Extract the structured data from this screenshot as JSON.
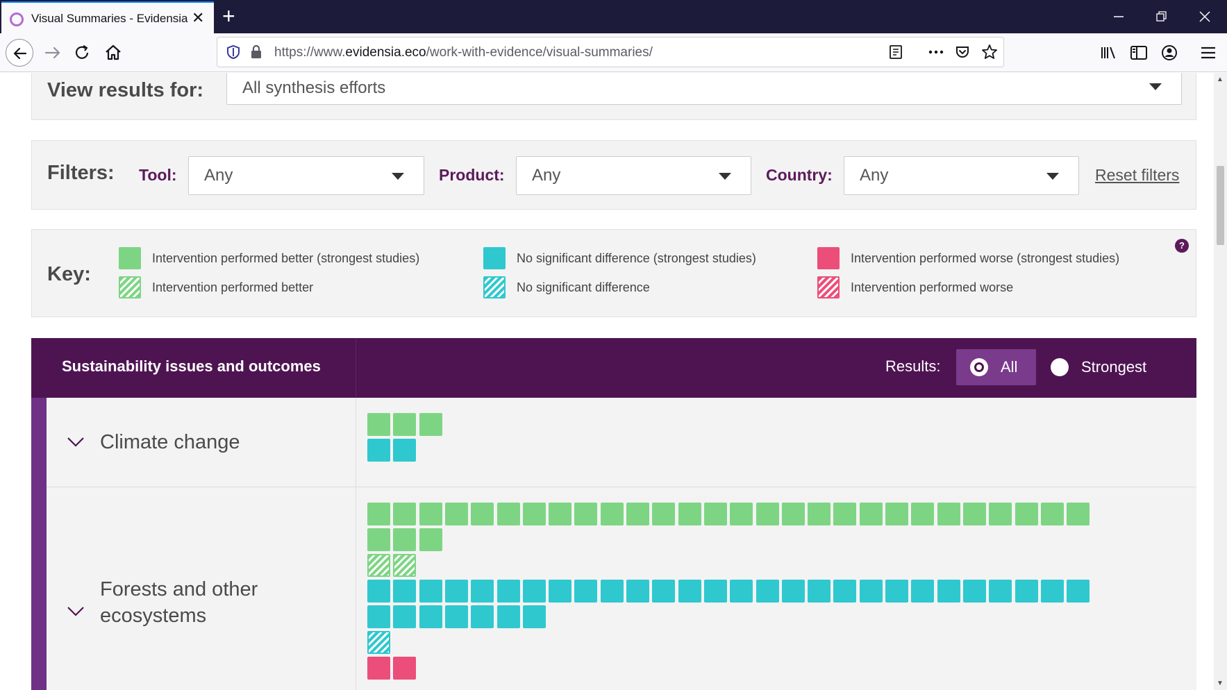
{
  "browser": {
    "tab_title": "Visual Summaries - Evidensia",
    "url_prefix": "https://www.",
    "url_host": "evidensia.eco",
    "url_path": "/work-with-evidence/visual-summaries/"
  },
  "view_results": {
    "label": "View results for:",
    "selected": "All synthesis efforts"
  },
  "filters": {
    "label": "Filters:",
    "tool_label": "Tool:",
    "tool_value": "Any",
    "product_label": "Product:",
    "product_value": "Any",
    "country_label": "Country:",
    "country_value": "Any",
    "reset_label": "Reset filters"
  },
  "key": {
    "label": "Key:",
    "help": "?",
    "items": [
      {
        "text": "Intervention performed better (strongest studies)",
        "color": "#7dd584",
        "pattern": "solid"
      },
      {
        "text": "Intervention performed better",
        "color": "#7dd584",
        "pattern": "hatched"
      },
      {
        "text": "No significant difference (strongest studies)",
        "color": "#2fc8cf",
        "pattern": "solid"
      },
      {
        "text": "No significant difference",
        "color": "#2fc8cf",
        "pattern": "hatched"
      },
      {
        "text": "Intervention performed worse (strongest studies)",
        "color": "#ec4e7a",
        "pattern": "solid"
      },
      {
        "text": "Intervention performed worse",
        "color": "#ec4e7a",
        "pattern": "hatched"
      }
    ]
  },
  "results": {
    "title": "Sustainability issues and outcomes",
    "results_label": "Results:",
    "options": [
      {
        "label": "All",
        "selected": true
      },
      {
        "label": "Strongest",
        "selected": false
      }
    ]
  },
  "outcomes": [
    {
      "label": "Climate change",
      "groups": [
        {
          "type": "better-strongest",
          "count": 3
        },
        {
          "type": "nodiff-strongest",
          "count": 2
        }
      ]
    },
    {
      "label": "Forests and other ecosystems",
      "groups": [
        {
          "type": "better-strongest",
          "count": 31
        },
        {
          "type": "better",
          "count": 2
        },
        {
          "type": "nodiff-strongest",
          "count": 35
        },
        {
          "type": "nodiff",
          "count": 1
        },
        {
          "type": "worse-strongest",
          "count": 2
        }
      ]
    }
  ]
}
